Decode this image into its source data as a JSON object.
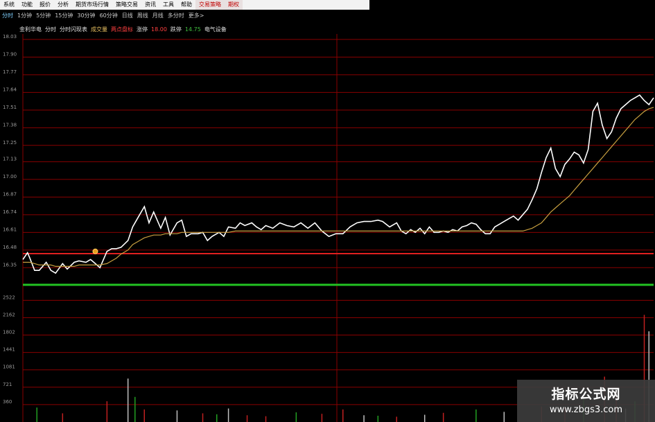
{
  "menubar": {
    "items": [
      "系统",
      "功能",
      "报价",
      "分析",
      "期货市场行情",
      "策略交易",
      "资讯",
      "工具",
      "帮助",
      "交易策略",
      "期权"
    ]
  },
  "periods": [
    "分时",
    "1分钟",
    "5分钟",
    "15分钟",
    "30分钟",
    "60分钟",
    "日线",
    "周线",
    "月线",
    "多分时",
    "更多>"
  ],
  "infobar": {
    "items": [
      {
        "text": "金利华电",
        "color": "#e0e0e0"
      },
      {
        "text": "分时",
        "color": "#e0e0e0"
      },
      {
        "text": "分时闪现表",
        "color": "#e0e0e0"
      },
      {
        "text": "成交量",
        "color": "#e8c060"
      },
      {
        "text": "两点盘标",
        "color": "#ff4040"
      },
      {
        "text": "涨停",
        "color": "#e0e0e0"
      },
      {
        "text": "18.00",
        "color": "#ff4040"
      },
      {
        "text": "跌停",
        "color": "#e0e0e0"
      },
      {
        "text": "14.75",
        "color": "#40c040"
      },
      {
        "text": "电气设备",
        "color": "#e0e0e0"
      }
    ]
  },
  "chart_data": [
    {
      "type": "line",
      "title": "",
      "yticks": [
        "18.03",
        "17.90",
        "17.77",
        "17.64",
        "17.51",
        "17.38",
        "17.25",
        "17.13",
        "17.00",
        "16.87",
        "16.74",
        "16.61",
        "16.48",
        "16.35"
      ],
      "ylim": [
        16.27,
        18.07
      ],
      "x": [
        0,
        2,
        3,
        5,
        7,
        10,
        12,
        14,
        17,
        19,
        22,
        24,
        27,
        29,
        31,
        33,
        36,
        38,
        40,
        42,
        45,
        47,
        50,
        52,
        54,
        56,
        59,
        61,
        63,
        66,
        68,
        70,
        72,
        75,
        77,
        79,
        81,
        84,
        86,
        88,
        91,
        93,
        95,
        98,
        100,
        102,
        104,
        107,
        110,
        113,
        116,
        119,
        122,
        125,
        128,
        131,
        134,
        137,
        140,
        143,
        146,
        149,
        152,
        154,
        157,
        160,
        162,
        164,
        166,
        168,
        170,
        172,
        174,
        176,
        178,
        180,
        182,
        184,
        186,
        188,
        190,
        192,
        194,
        196,
        198,
        200,
        202,
        204,
        206,
        208,
        210,
        212,
        214,
        216,
        218,
        220,
        222,
        224,
        226,
        228,
        230,
        232,
        234,
        236,
        238,
        240,
        242,
        244,
        246,
        248,
        250,
        252,
        254,
        256,
        258,
        260,
        262,
        264,
        266,
        268,
        270
      ],
      "series": [
        {
          "color": "#ffffff",
          "values": [
            16.41,
            16.46,
            16.42,
            16.33,
            16.33,
            16.39,
            16.33,
            16.31,
            16.38,
            16.34,
            16.39,
            16.4,
            16.39,
            16.41,
            16.38,
            16.35,
            16.47,
            16.49,
            16.49,
            16.5,
            16.55,
            16.65,
            16.74,
            16.8,
            16.68,
            16.76,
            16.64,
            16.72,
            16.59,
            16.68,
            16.7,
            16.58,
            16.6,
            16.6,
            16.61,
            16.55,
            16.58,
            16.61,
            16.58,
            16.65,
            16.64,
            16.68,
            16.66,
            16.68,
            16.65,
            16.63,
            16.66,
            16.64,
            16.68,
            16.66,
            16.65,
            16.68,
            16.64,
            16.68,
            16.62,
            16.58,
            16.6,
            16.6,
            16.65,
            16.68,
            16.69,
            16.69,
            16.7,
            16.69,
            16.65,
            16.68,
            16.62,
            16.6,
            16.63,
            16.61,
            16.64,
            16.6,
            16.65,
            16.61,
            16.61,
            16.62,
            16.61,
            16.63,
            16.62,
            16.65,
            16.66,
            16.68,
            16.67,
            16.63,
            16.6,
            16.6,
            16.65,
            16.67,
            16.69,
            16.71,
            16.73,
            16.7,
            16.74,
            16.78,
            16.85,
            16.93,
            17.05,
            17.16,
            17.23,
            17.08,
            17.02,
            17.11,
            17.15,
            17.2,
            17.18,
            17.12,
            17.22,
            17.5,
            17.56,
            17.4,
            17.3,
            17.35,
            17.45,
            17.52,
            17.55,
            17.58,
            17.6,
            17.62,
            17.58,
            17.55,
            17.6
          ]
        },
        {
          "color": "#c8a040",
          "values": [
            16.39,
            16.39,
            16.39,
            16.38,
            16.37,
            16.37,
            16.37,
            16.36,
            16.36,
            16.36,
            16.36,
            16.37,
            16.37,
            16.37,
            16.37,
            16.37,
            16.38,
            16.4,
            16.42,
            16.45,
            16.48,
            16.52,
            16.55,
            16.57,
            16.58,
            16.59,
            16.59,
            16.6,
            16.6,
            16.6,
            16.61,
            16.61,
            16.61,
            16.61,
            16.61,
            16.61,
            16.61,
            16.61,
            16.61,
            16.61,
            16.62,
            16.62,
            16.62,
            16.62,
            16.62,
            16.62,
            16.62,
            16.62,
            16.62,
            16.62,
            16.62,
            16.62,
            16.62,
            16.62,
            16.62,
            16.62,
            16.62,
            16.62,
            16.62,
            16.62,
            16.62,
            16.62,
            16.62,
            16.62,
            16.62,
            16.62,
            16.62,
            16.62,
            16.62,
            16.62,
            16.62,
            16.62,
            16.62,
            16.62,
            16.62,
            16.62,
            16.62,
            16.62,
            16.62,
            16.62,
            16.62,
            16.62,
            16.62,
            16.62,
            16.62,
            16.62,
            16.62,
            16.62,
            16.62,
            16.62,
            16.62,
            16.62,
            16.62,
            16.63,
            16.64,
            16.66,
            16.68,
            16.72,
            16.76,
            16.79,
            16.82,
            16.85,
            16.88,
            16.92,
            16.96,
            17.0,
            17.04,
            17.08,
            17.12,
            17.16,
            17.2,
            17.24,
            17.28,
            17.32,
            17.36,
            17.4,
            17.44,
            17.47,
            17.5,
            17.52,
            17.53
          ]
        }
      ]
    },
    {
      "type": "bar",
      "title": "",
      "yticks": [
        "2522",
        "2162",
        "1802",
        "1441",
        "1081",
        "721",
        "360"
      ],
      "ylim": [
        0,
        2700
      ],
      "x": [
        6,
        17,
        36,
        45,
        48,
        52,
        66,
        77,
        83,
        88,
        96,
        104,
        117,
        128,
        137,
        146,
        152,
        160,
        172,
        180,
        194,
        206,
        222,
        232,
        240,
        249,
        254,
        258,
        262,
        266,
        268
      ],
      "values": [
        300,
        180,
        430,
        900,
        520,
        260,
        240,
        180,
        160,
        280,
        140,
        120,
        200,
        170,
        260,
        140,
        130,
        110,
        150,
        190,
        260,
        210,
        320,
        300,
        500,
        940,
        620,
        280,
        430,
        2220,
        1880
      ]
    }
  ]
}
